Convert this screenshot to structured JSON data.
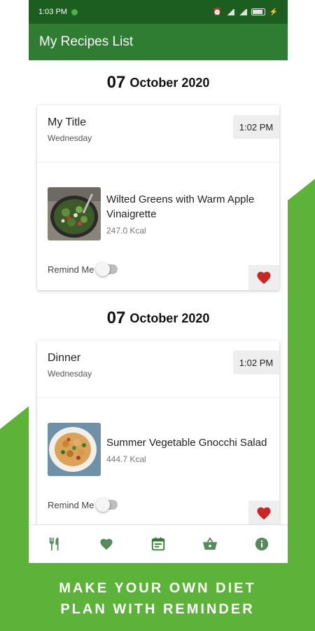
{
  "status_bar": {
    "time": "1:03 PM"
  },
  "app_bar": {
    "title": "My Recipes List"
  },
  "entries": [
    {
      "date_day": "07",
      "date_month_year": "October 2020",
      "meal_title": "My Title",
      "weekday": "Wednesday",
      "time": "1:02 PM",
      "recipe_name": "Wilted Greens with Warm Apple Vinaigrette",
      "kcal": "247.0 Kcal",
      "remind_label": "Remind Me",
      "remind_on": false,
      "favorite": true,
      "thumb_icon": "salad-bowl-image"
    },
    {
      "date_day": "07",
      "date_month_year": "October 2020",
      "meal_title": "Dinner",
      "weekday": "Wednesday",
      "time": "1:02 PM",
      "recipe_name": "Summer Vegetable Gnocchi Salad",
      "kcal": "444.7 Kcal",
      "remind_label": "Remind Me",
      "remind_on": false,
      "favorite": true,
      "thumb_icon": "gnocchi-plate-image"
    }
  ],
  "bottom_nav": [
    {
      "name": "recipes",
      "icon": "fork-knife-icon"
    },
    {
      "name": "favorites",
      "icon": "heart-icon"
    },
    {
      "name": "planner",
      "icon": "calendar-icon",
      "active": true
    },
    {
      "name": "shopping",
      "icon": "basket-icon"
    },
    {
      "name": "info",
      "icon": "info-icon"
    }
  ],
  "tagline": {
    "line1": "MAKE YOUR OWN DIET",
    "line2": "PLAN WITH REMINDER"
  },
  "colors": {
    "primary_dark": "#1b5e20",
    "primary": "#2e7d32",
    "promo_green": "#5db33a",
    "heart_red": "#c62828",
    "nav_icon": "#558b5a"
  }
}
